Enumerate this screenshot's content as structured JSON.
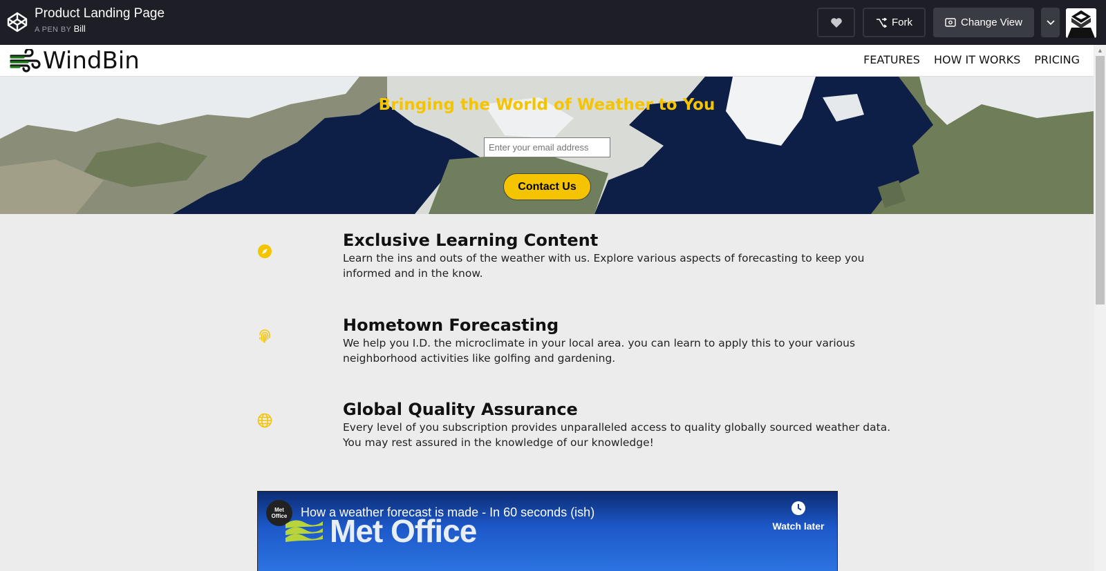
{
  "codepen": {
    "title": "Product Landing Page",
    "byline": "A PEN BY",
    "author": "Bill",
    "fork_label": "Fork",
    "change_view_label": "Change View"
  },
  "site": {
    "brand": "WindBin",
    "nav": [
      "FEATURES",
      "HOW IT WORKS",
      "PRICING"
    ]
  },
  "hero": {
    "title": "Bringing the World of Weather to You",
    "email_placeholder": "Enter your email address",
    "cta_label": "Contact Us"
  },
  "features": [
    {
      "icon": "compass-icon",
      "title": "Exclusive Learning Content",
      "text": "Learn the ins and outs of the weather with us. Explore various aspects of forecasting to keep you informed and in the know."
    },
    {
      "icon": "fingerprint-icon",
      "title": "Hometown Forecasting",
      "text": "We help you I.D. the microclimate in your local area. you can learn to apply this to your various neighborhood activities like golfing and gardening."
    },
    {
      "icon": "globe-icon",
      "title": "Global Quality Assurance",
      "text": "Every level of you subscription provides unparalleled access to quality globally sourced weather data. You may rest assured in the knowledge of our knowledge!"
    }
  ],
  "video": {
    "channel_badge": "Met Office",
    "title": "How a weather forecast is made - In 60 seconds (ish)",
    "logo_text": "Met Office",
    "watch_later_label": "Watch later"
  },
  "colors": {
    "accent": "#f5c400",
    "codepen_bar": "#1e1f26",
    "brand_green": "#1b7a1b"
  }
}
